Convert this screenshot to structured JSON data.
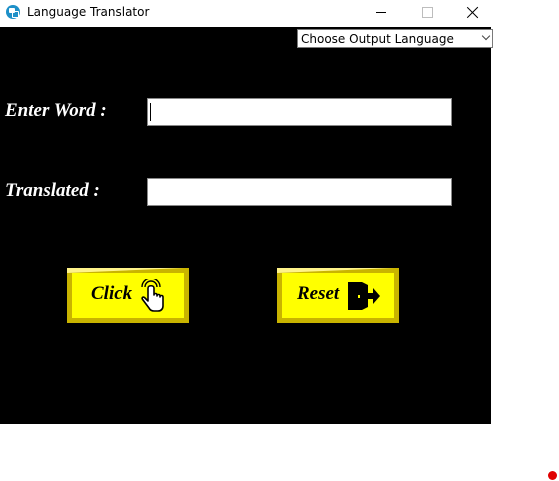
{
  "window": {
    "title": "Language Translator",
    "app_icon": "translate-app-icon",
    "controls": [
      "minimize-icon",
      "maximize-icon",
      "close-icon"
    ]
  },
  "language_select": {
    "value": "Choose Output Language"
  },
  "form": {
    "word_label": "Enter Word :",
    "word_value": "",
    "translated_label": "Translated :",
    "translated_value": ""
  },
  "buttons": {
    "click_label": "Click",
    "click_icon": "pointing-hand-icon",
    "reset_label": "Reset",
    "reset_icon": "exit-door-icon"
  },
  "colors": {
    "canvas": "#000000",
    "button_face": "#ffff00",
    "label_text": "#ffffff",
    "status_dot": "#e00000"
  }
}
